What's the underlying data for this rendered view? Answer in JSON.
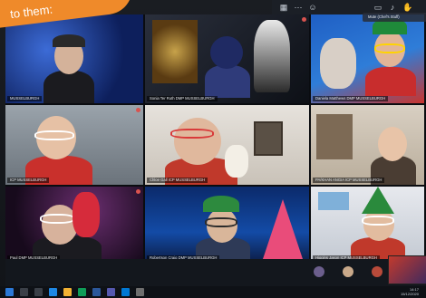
{
  "banner": {
    "text": "to them:"
  },
  "call": {
    "self_label": "Mute (Chef's Stuff)",
    "participants": [
      {
        "name": "MUSSELBURGH",
        "mic": false
      },
      {
        "name": "Sonia Ter Ruth DMP MUSSELBURGH",
        "mic": true
      },
      {
        "name": "Daniela Matthews DMP MUSSELBURGH",
        "mic": false
      },
      {
        "name": "ICP MUSSELBURGH",
        "mic": true
      },
      {
        "name": "Chloe Gall ICP MUSSELBURGH",
        "mic": false
      },
      {
        "name": "PA/KHAN ANGIA ICP MUSSELBURGH",
        "mic": false
      },
      {
        "name": "Paul DMP MUSSELBURGH",
        "mic": true
      },
      {
        "name": "Robertson Craig DMP MUSSELBURGH",
        "mic": false
      },
      {
        "name": "Higgins Jason ICP MUSSELBURGH",
        "mic": false
      }
    ]
  },
  "taskbar": {
    "time": "14:17",
    "date": "15/12/2020"
  },
  "colors": {
    "banner": "#ef8a2a",
    "mic_muted": "#d9534f"
  }
}
